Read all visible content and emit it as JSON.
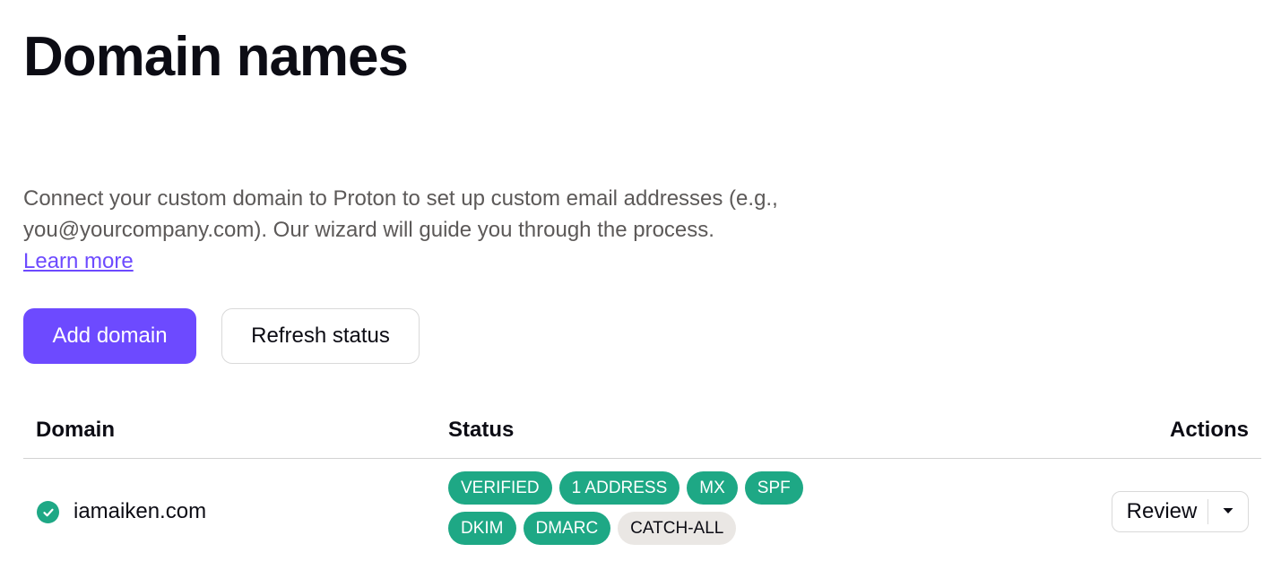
{
  "page": {
    "title": "Domain names",
    "description": "Connect your custom domain to Proton to set up custom email addresses (e.g., you@yourcompany.com). Our wizard will guide you through the process.",
    "learn_more": "Learn more"
  },
  "buttons": {
    "add_domain": "Add domain",
    "refresh_status": "Refresh status"
  },
  "table": {
    "headers": {
      "domain": "Domain",
      "status": "Status",
      "actions": "Actions"
    },
    "rows": [
      {
        "status_icon": "check-circle-icon",
        "domain": "iamaiken.com",
        "badges_line1": [
          "VERIFIED",
          "1 ADDRESS",
          "MX",
          "SPF"
        ],
        "badges_line2": [
          "DKIM",
          "DMARC",
          "CATCH-ALL"
        ],
        "neutral_badge": "CATCH-ALL",
        "action_label": "Review",
        "action_menu_icon": "caret-down-icon"
      }
    ]
  },
  "colors": {
    "primary": "#6d4aff",
    "success": "#1ea885",
    "neutral_badge": "#eae7e4",
    "text": "#0c0c14",
    "muted_text": "#5c5958"
  }
}
